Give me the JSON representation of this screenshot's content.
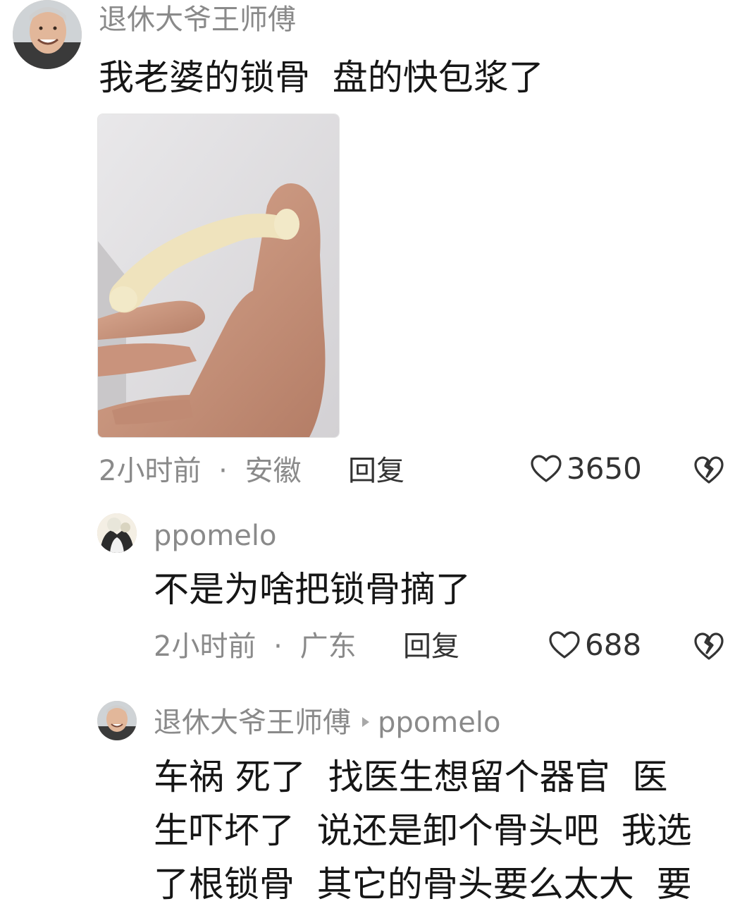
{
  "comments": [
    {
      "username": "退休大爷王师傅",
      "text": "我老婆的锁骨  盘的快包浆了",
      "time": "2小时前",
      "location": "安徽",
      "meta_sep": "·",
      "reply_label": "回复",
      "likes": "3650",
      "avatar_icon": "avatar-elderly-man",
      "image_icon": "clavicle-bone-in-hand-photo"
    },
    {
      "username": "ppomelo",
      "text": "不是为啥把锁骨摘了",
      "time": "2小时前",
      "location": "广东",
      "meta_sep": "·",
      "reply_label": "回复",
      "likes": "688",
      "avatar_icon": "avatar-cat"
    },
    {
      "username": "退休大爷王师傅",
      "reply_to": "ppomelo",
      "text_lines": [
        "车祸 死了  找医生想留个器官  医",
        "生吓坏了  说还是卸个骨头吧  我选",
        "了根锁骨  其它的骨头要么太大  要"
      ],
      "avatar_icon": "avatar-elderly-man"
    }
  ],
  "colors": {
    "text": "#161616",
    "secondary": "#8a8a8a",
    "action": "#333333"
  }
}
